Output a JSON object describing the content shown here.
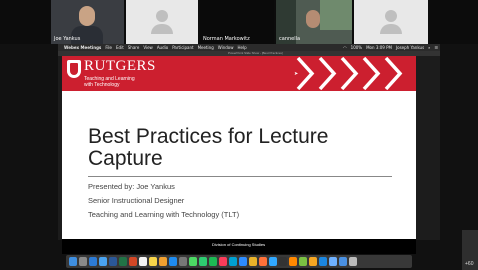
{
  "participants": [
    {
      "name": "Joe Yankus",
      "type": "video",
      "bg": "#3a3d42"
    },
    {
      "name": "",
      "type": "avatar",
      "bg": "#e8e8e8"
    },
    {
      "name": "Norman Markowitz",
      "type": "dark",
      "bg": "#0a0a0a"
    },
    {
      "name": "cannella",
      "type": "video",
      "bg": "#4f5b52"
    },
    {
      "name": "",
      "type": "avatar",
      "bg": "#e8e8e8"
    }
  ],
  "menubar": {
    "apple": "",
    "app_name": "Webex Meetings",
    "items": [
      "File",
      "Edit",
      "Share",
      "View",
      "Audio",
      "Participant",
      "Meeting",
      "Window",
      "Help"
    ],
    "battery": "100%",
    "clock": "Mon 3:09 PM",
    "user": "Joseph Yankus"
  },
  "window_title": "PowerPoint Slide Show - [Best Practices]",
  "slide": {
    "brand": "RUTGERS",
    "brand_sub_1": "Teaching and Learning",
    "brand_sub_2": "with Technology",
    "title_line_1": "Best Practices for Lecture",
    "title_line_2": "Capture",
    "presented_by": "Presented by: Joe Yankus",
    "role": "Senior Instructional Designer",
    "department": "Teaching and Learning with Technology (TLT)",
    "footer": "Division of Continuing Studies",
    "colors": {
      "banner": "#cc1f2f",
      "chevron": "#ffffff"
    }
  },
  "dock_icons": [
    "finder-icon",
    "launchpad-icon",
    "safari-icon",
    "mail-icon",
    "word-icon",
    "excel-icon",
    "powerpoint-icon",
    "calendar-icon",
    "notes-icon",
    "photos-icon",
    "appstore-icon",
    "preferences-icon",
    "messages-icon",
    "facetime-icon",
    "spotify-icon",
    "music-icon",
    "webex-icon",
    "zoom-icon",
    "chrome-icon",
    "firefox-icon",
    "photoshop-icon",
    "terminal-icon",
    "vlc-icon",
    "maps-icon",
    "pages-icon",
    "keynote-icon",
    "folder-icon",
    "downloads-icon",
    "trash-icon"
  ],
  "dock_colors": [
    "#3f8fe0",
    "#8a8a8a",
    "#2d7bd5",
    "#4aa3f0",
    "#2b5797",
    "#217346",
    "#d24726",
    "#f4f4f4",
    "#f7d54a",
    "#f0a030",
    "#1f8cf0",
    "#777",
    "#4cd964",
    "#2ecc71",
    "#1db954",
    "#fa3c5a",
    "#00a0d1",
    "#2d8cff",
    "#e9b32a",
    "#ff7139",
    "#31a8ff",
    "#333",
    "#ff8800",
    "#7ac143",
    "#f5a623",
    "#1c87e0",
    "#6fb1ff",
    "#4a90e2",
    "#bbbbbb"
  ],
  "more_count": "+60"
}
